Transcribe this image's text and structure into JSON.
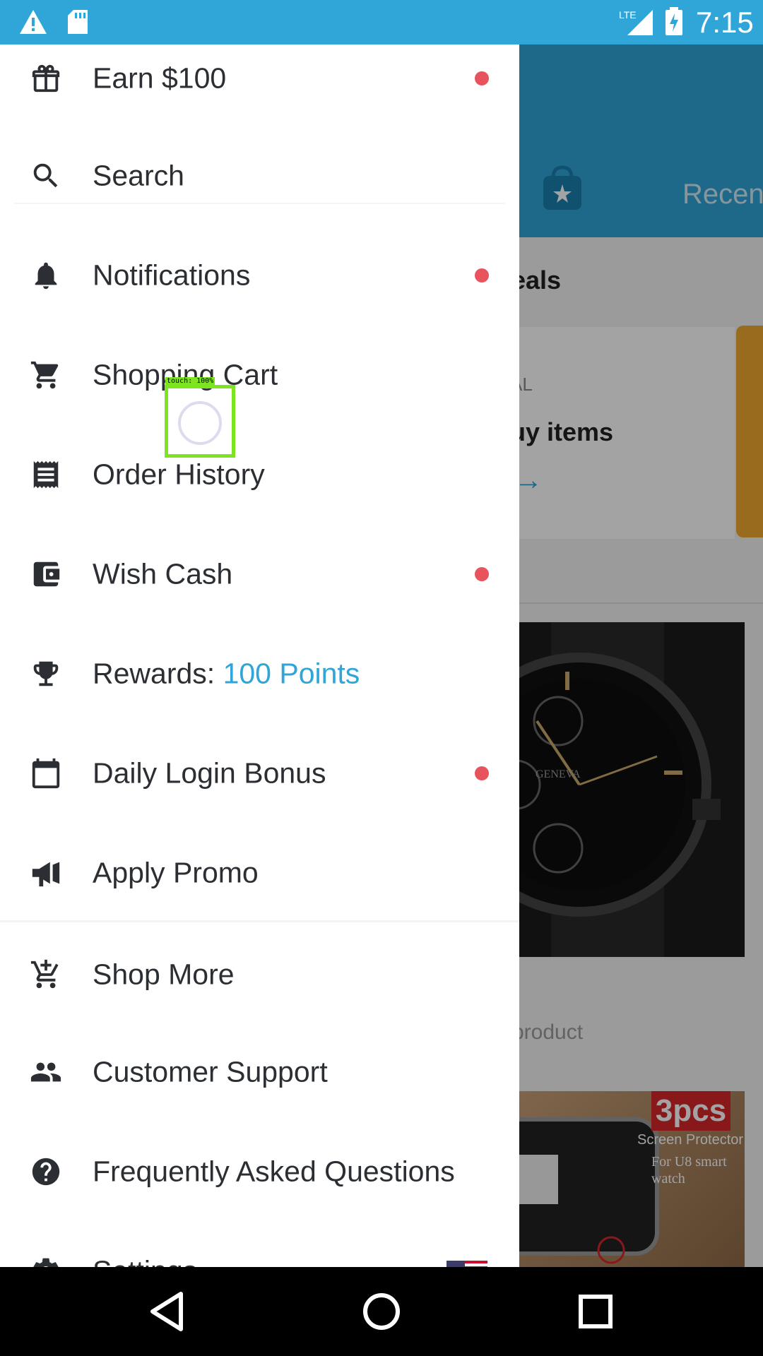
{
  "status_bar": {
    "time": "7:15",
    "network": "LTE",
    "icons": [
      "warning-icon",
      "sd-card-icon",
      "signal-icon",
      "battery-charging-icon"
    ]
  },
  "background": {
    "header_recent": "Recen",
    "deals_title": "eals",
    "card_small": "AL",
    "card_title": "uy items",
    "product_text": "product",
    "promo_badge": "3pcs",
    "promo_line1": "Screen Protector",
    "promo_line2": "For U8 smart watch",
    "watch_brand": "GENEVA"
  },
  "drawer": {
    "items": [
      {
        "label": "Earn $100",
        "icon": "gift-icon",
        "has_dot": true
      },
      {
        "label": "Search",
        "icon": "search-icon",
        "has_dot": false
      },
      {
        "label": "Notifications",
        "icon": "bell-icon",
        "has_dot": true
      },
      {
        "label": "Shopping Cart",
        "icon": "cart-icon",
        "has_dot": false
      },
      {
        "label": "Order History",
        "icon": "receipt-icon",
        "has_dot": false
      },
      {
        "label": "Wish Cash",
        "icon": "wallet-icon",
        "has_dot": true
      },
      {
        "label": "Rewards: ",
        "points": "100 Points",
        "icon": "trophy-icon",
        "has_dot": false
      },
      {
        "label": "Daily Login Bonus",
        "icon": "calendar-icon",
        "has_dot": true
      },
      {
        "label": "Apply Promo",
        "icon": "megaphone-icon",
        "has_dot": false
      },
      {
        "label": "Shop More",
        "icon": "cart-add-icon",
        "has_dot": false
      },
      {
        "label": "Customer Support",
        "icon": "people-icon",
        "has_dot": false
      },
      {
        "label": "Frequently Asked Questions",
        "icon": "help-icon",
        "has_dot": false
      },
      {
        "label": "Settings",
        "icon": "gear-icon",
        "has_dot": false
      }
    ]
  },
  "touch_indicator": {
    "label": "touch: 100%"
  },
  "nav_bar": {
    "buttons": [
      "back-icon",
      "home-icon",
      "recents-icon"
    ]
  },
  "colors": {
    "accent": "#2fa5d8",
    "dot": "#e8545d",
    "text": "#2b2f33"
  }
}
